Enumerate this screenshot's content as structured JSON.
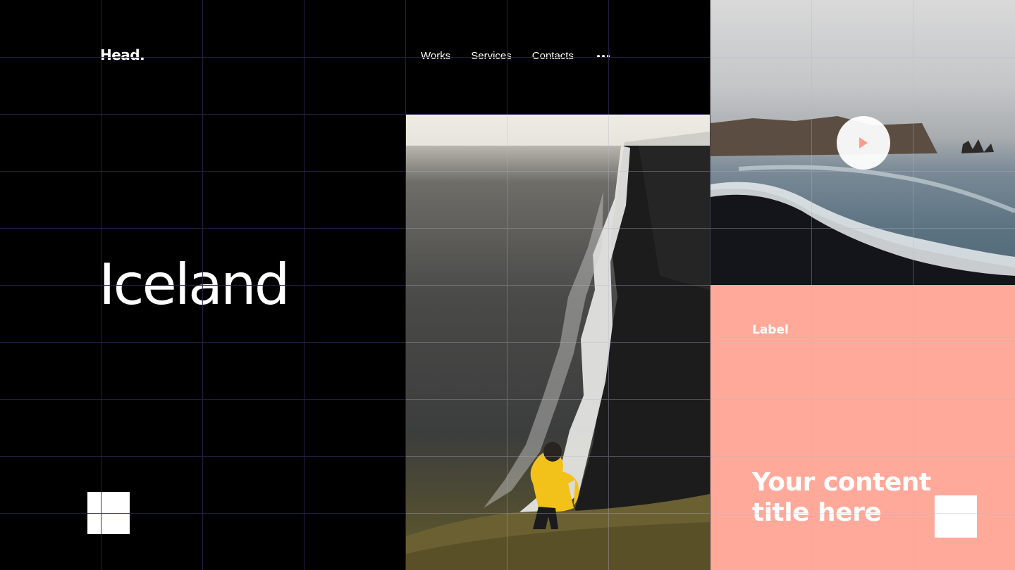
{
  "header": {
    "logo": "Head.",
    "nav": [
      {
        "label": "Works"
      },
      {
        "label": "Services"
      },
      {
        "label": "Contacts"
      }
    ],
    "more_icon": "ellipsis-icon"
  },
  "hero": {
    "title": "Iceland"
  },
  "video": {
    "play_icon": "play-icon"
  },
  "card": {
    "label": "Label",
    "title": "Your content title here"
  },
  "colors": {
    "background": "#000000",
    "accent": "#ffa99a",
    "play_arrow": "#ff9d8c",
    "grid_line": "#252345",
    "grid_line_light": "#b9b4cf",
    "text": "#ffffff"
  }
}
